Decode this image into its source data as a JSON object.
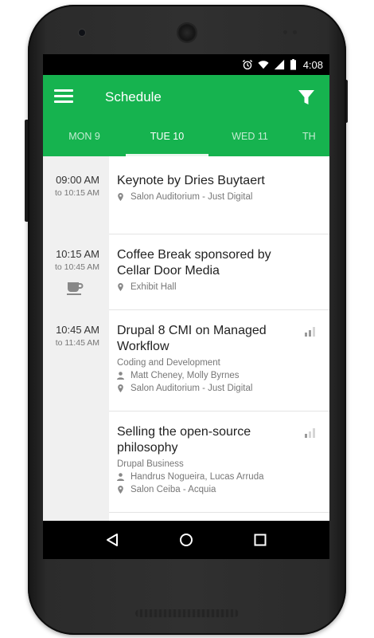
{
  "status_bar": {
    "time": "4:08"
  },
  "app_bar": {
    "title": "Schedule"
  },
  "tabs": [
    {
      "label": "MON 9"
    },
    {
      "label": "TUE 10"
    },
    {
      "label": "WED 11"
    },
    {
      "label": "TH"
    }
  ],
  "schedule": {
    "slots": [
      {
        "start": "09:00 AM",
        "end": "to 10:15 AM"
      },
      {
        "start": "10:15 AM",
        "end": "to 10:45 AM"
      },
      {
        "start": "10:45 AM",
        "end": "to 11:45 AM"
      }
    ],
    "sessions": [
      {
        "title": "Keynote by Dries Buytaert",
        "location": "Salon Auditorium - Just Digital"
      },
      {
        "title": "Coffee Break sponsored by Cellar Door Media",
        "location": "Exhibit Hall"
      },
      {
        "title": "Drupal 8 CMI on Managed Workflow",
        "track": "Coding and Development",
        "speakers": "Matt Cheney, Molly Byrnes",
        "location": "Salon Auditorium - Just Digital"
      },
      {
        "title": "Selling the open-source philosophy",
        "track": "Drupal Business",
        "speakers": "Handrus Nogueira, Lucas Arruda",
        "location": "Salon Ceiba - Acquia"
      }
    ]
  },
  "icons": {
    "menu": "menu-icon",
    "filter": "filter-icon",
    "location": "location-pin-icon",
    "speaker": "person-icon",
    "coffee": "coffee-cup-icon",
    "level": "signal-bars-icon",
    "alarm": "alarm-icon",
    "wifi": "wifi-icon",
    "cell": "cell-signal-icon",
    "battery": "battery-icon",
    "back": "back-icon",
    "home": "home-icon",
    "recents": "recents-icon"
  },
  "colors": {
    "accent": "#16b34f",
    "time_column": "#f0f0f0",
    "text_primary": "#222222",
    "text_secondary": "#777777"
  }
}
